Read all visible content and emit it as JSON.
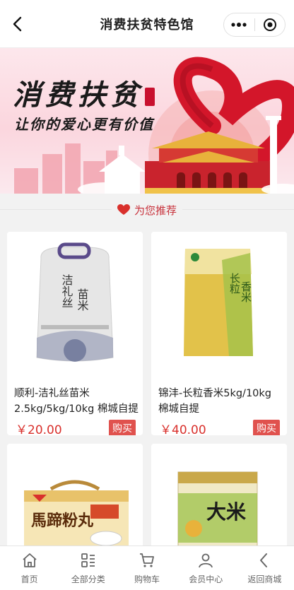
{
  "header": {
    "title": "消费扶贫特色馆"
  },
  "banner": {
    "title": "消费扶贫",
    "subtitle": "让你的爱心更有价值"
  },
  "section": {
    "label": "为您推荐"
  },
  "products": [
    {
      "name": "顺利-洁礼丝苗米2.5kg/5kg/10kg 棉城自提",
      "price": "￥20.00",
      "buy_label": "购买"
    },
    {
      "name": "锦沣-长粒香米5kg/10kg 棉城自提",
      "price": "￥40.00",
      "buy_label": "购买"
    },
    {
      "name": "",
      "price": "",
      "buy_label": ""
    },
    {
      "name": "",
      "price": "",
      "buy_label": ""
    }
  ],
  "tabbar": [
    {
      "label": "首页",
      "icon": "home-icon"
    },
    {
      "label": "全部分类",
      "icon": "category-icon"
    },
    {
      "label": "购物车",
      "icon": "cart-icon"
    },
    {
      "label": "会员中心",
      "icon": "user-icon"
    },
    {
      "label": "返回商城",
      "icon": "return-icon"
    }
  ],
  "colors": {
    "accent": "#d9302c",
    "buy": "#e0524e",
    "section_text": "#c8323c"
  }
}
